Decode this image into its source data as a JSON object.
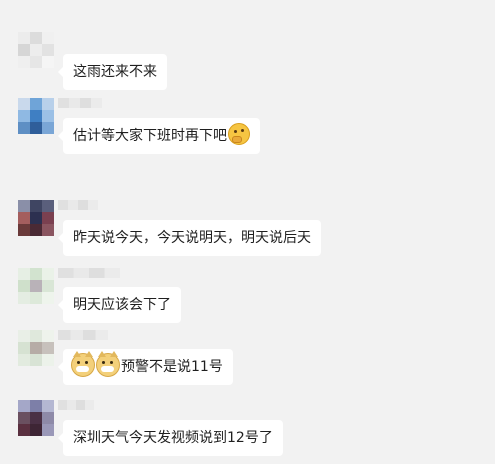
{
  "messages": [
    {
      "id": "m1",
      "text": "这雨还来不来",
      "emoji_suffix": "",
      "emoji_prefix": []
    },
    {
      "id": "m2",
      "text": "估计等大家下班时再下吧",
      "emoji_suffix": "thinking-face",
      "emoji_prefix": []
    },
    {
      "id": "m3",
      "text": "昨天说今天，今天说明天，明天说后天",
      "emoji_suffix": "",
      "emoji_prefix": []
    },
    {
      "id": "m4",
      "text": "明天应该会下了",
      "emoji_suffix": "",
      "emoji_prefix": []
    },
    {
      "id": "m5",
      "text": "预警不是说11号",
      "emoji_suffix": "",
      "emoji_prefix": [
        "doge-face",
        "doge-face"
      ]
    },
    {
      "id": "m6",
      "text": "深圳天气今天发视频说到12号了",
      "emoji_suffix": "",
      "emoji_prefix": []
    }
  ],
  "colors": {
    "background": "#f2f2f2",
    "bubble": "#ffffff",
    "text": "#1f1f1f"
  }
}
